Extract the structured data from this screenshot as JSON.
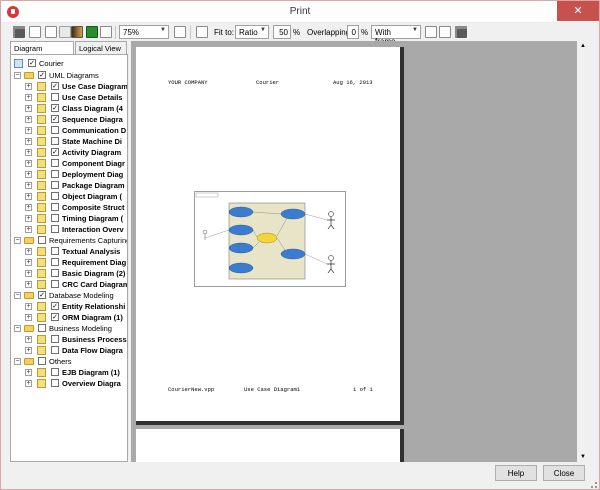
{
  "window": {
    "title": "Print",
    "close_glyph": "✕"
  },
  "toolbar": {
    "zoom": "75%",
    "fit_to_label": "Fit to:",
    "fit_to_value": "Ratio",
    "ratio_value": "50",
    "ratio_unit": "%",
    "overlapping_label": "Overlapping:",
    "overlapping_value": "0",
    "overlapping_unit": "%",
    "frame_value": "With frame",
    "dropdown_glyph": "▼"
  },
  "tabs": {
    "navigator": "Diagram Navigator",
    "logical": "Logical View"
  },
  "tree": {
    "root": "Courier",
    "uml": "UML Diagrams",
    "uml_items": [
      "Use Case Diagram",
      "Use Case Details",
      "Class Diagram (4",
      "Sequence Diagra",
      "Communication D",
      "State Machine Di",
      "Activity Diagram",
      "Component Diagr",
      "Deployment Diag",
      "Package Diagram",
      "Object Diagram (",
      "Composite Struct",
      "Timing Diagram (",
      "Interaction Overv"
    ],
    "req": "Requirements Capturing",
    "req_items": [
      "Textual Analysis",
      "Requirement Diag",
      "Basic Diagram (2)",
      "CRC Card Diagram"
    ],
    "db": "Database Modeling",
    "db_items": [
      "Entity Relationshi",
      "ORM Diagram (1)"
    ],
    "biz": "Business Modeling",
    "biz_items": [
      "Business Process",
      "Data Flow Diagra"
    ],
    "others": "Others",
    "others_items": [
      "EJB Diagram (1)",
      "Overview Diagra"
    ],
    "check_glyph": "✓",
    "plus_glyph": "+",
    "minus_glyph": "−"
  },
  "page": {
    "company": "YOUR COMPANY",
    "project": "Courier",
    "date": "Aug 16, 2013",
    "file": "CourierNew.vpp",
    "diagram": "Use Case Diagram1",
    "page_no": "1 of 1"
  },
  "buttons": {
    "help": "Help",
    "close": "Close"
  }
}
